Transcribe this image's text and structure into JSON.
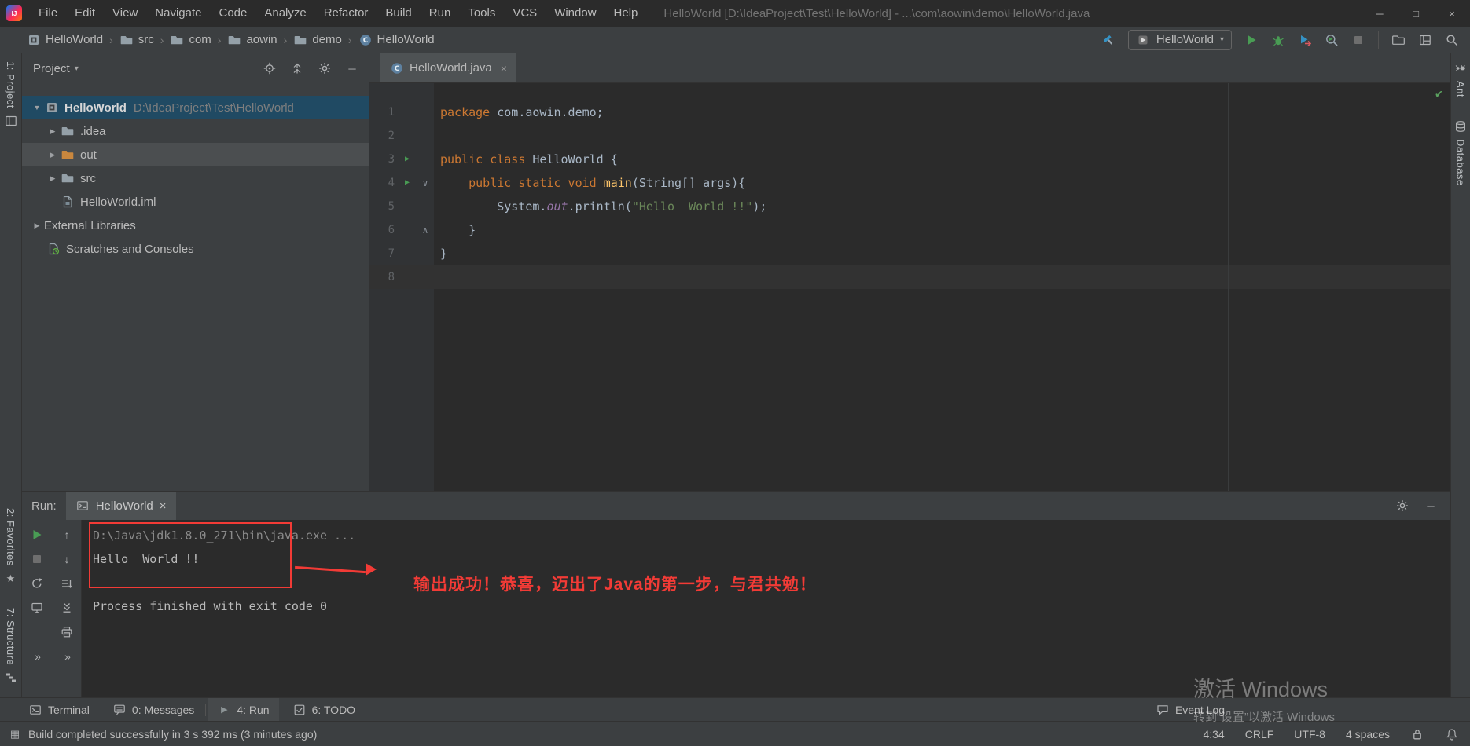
{
  "colors": {
    "keyword": "#CC7832",
    "string": "#6A8759",
    "method": "#FFC66B",
    "field": "#9876AA",
    "run_green": "#499C54",
    "annotation_red": "#F23B36",
    "selection_blue": "#204A63"
  },
  "window": {
    "title": "HelloWorld [D:\\IdeaProject\\Test\\HelloWorld] - ...\\com\\aowin\\demo\\HelloWorld.java",
    "menus": [
      "File",
      "Edit",
      "View",
      "Navigate",
      "Code",
      "Analyze",
      "Refactor",
      "Build",
      "Run",
      "Tools",
      "VCS",
      "Window",
      "Help"
    ]
  },
  "navbar": {
    "breadcrumbs": [
      {
        "label": "HelloWorld",
        "icon": "project"
      },
      {
        "label": "src",
        "icon": "folder"
      },
      {
        "label": "com",
        "icon": "folder"
      },
      {
        "label": "aowin",
        "icon": "folder"
      },
      {
        "label": "demo",
        "icon": "folder"
      },
      {
        "label": "HelloWorld",
        "icon": "class"
      }
    ],
    "config_label": "HelloWorld",
    "left_controls": [
      "build-hammer"
    ],
    "run_controls": [
      "run",
      "debug",
      "coverage",
      "profiler",
      "stop"
    ],
    "right_controls": [
      "toolwindow-folder",
      "hide-panels",
      "search-everywhere"
    ]
  },
  "stripes": {
    "left_top": [
      {
        "label": "1: Project",
        "icon": "project-tool"
      }
    ],
    "left_bottom": [
      {
        "label": "2: Favorites",
        "icon": "star"
      },
      {
        "label": "7: Structure",
        "icon": "structure"
      }
    ],
    "right": [
      {
        "label": "Ant",
        "icon": "ant"
      },
      {
        "label": "Database",
        "icon": "database"
      }
    ]
  },
  "project": {
    "header": "Project",
    "header_controls": [
      "locate",
      "collapse-all",
      "settings",
      "hide"
    ],
    "tree": [
      {
        "indent": 0,
        "arrow": "down",
        "icon": "project",
        "label": "HelloWorld",
        "suffix": "D:\\IdeaProject\\Test\\HelloWorld",
        "bold": true,
        "state": "selected"
      },
      {
        "indent": 1,
        "arrow": "right",
        "icon": "folder",
        "label": ".idea",
        "state": ""
      },
      {
        "indent": 1,
        "arrow": "right",
        "icon": "folder-excluded",
        "label": "out",
        "state": "hover"
      },
      {
        "indent": 1,
        "arrow": "right",
        "icon": "folder",
        "label": "src",
        "state": ""
      },
      {
        "indent": 1,
        "arrow": "none",
        "icon": "module-file",
        "label": "HelloWorld.iml",
        "state": ""
      },
      {
        "indent": 0,
        "arrow": "right",
        "icon": "",
        "label": "External Libraries",
        "state": ""
      },
      {
        "indent": 1,
        "arrow": "skip",
        "icon": "scratches",
        "label": "Scratches and Consoles",
        "state": ""
      }
    ]
  },
  "editor": {
    "tab": "HelloWorld.java",
    "code": [
      {
        "num": "1",
        "tokens": [
          {
            "t": "kw",
            "s": "package"
          },
          {
            "t": "pl",
            "s": " com.aowin.demo;"
          }
        ]
      },
      {
        "num": "2",
        "tokens": []
      },
      {
        "num": "3",
        "run": true,
        "tokens": [
          {
            "t": "kw",
            "s": "public class"
          },
          {
            "t": "pl",
            "s": " HelloWorld {"
          }
        ]
      },
      {
        "num": "4",
        "run": true,
        "fold": "down",
        "tokens": [
          {
            "t": "pl",
            "s": "    "
          },
          {
            "t": "kw",
            "s": "public static void"
          },
          {
            "t": "pl",
            "s": " "
          },
          {
            "t": "me",
            "s": "main"
          },
          {
            "t": "pl",
            "s": "(String[] args){"
          }
        ]
      },
      {
        "num": "5",
        "tokens": [
          {
            "t": "pl",
            "s": "        System."
          },
          {
            "t": "fi",
            "s": "out"
          },
          {
            "t": "pl",
            "s": ".println("
          },
          {
            "t": "st",
            "s": "\"Hello  World !!\""
          },
          {
            "t": "pl",
            "s": ");"
          }
        ]
      },
      {
        "num": "6",
        "fold": "up",
        "tokens": [
          {
            "t": "pl",
            "s": "    }"
          }
        ]
      },
      {
        "num": "7",
        "tokens": [
          {
            "t": "pl",
            "s": "}"
          }
        ]
      },
      {
        "num": "8",
        "caret": true,
        "tokens": []
      }
    ]
  },
  "run": {
    "label": "Run:",
    "tab": "HelloWorld",
    "header_controls": [
      "settings",
      "hide"
    ],
    "toolbar": [
      "rerun",
      "up",
      "stop",
      "down",
      "restart",
      "sort",
      "monitor",
      "scroll-end",
      "",
      "printer",
      "more",
      "more"
    ],
    "console": [
      {
        "kind": "cmd",
        "text": "D:\\Java\\jdk1.8.0_271\\bin\\java.exe ..."
      },
      {
        "kind": "out",
        "text": "Hello  World !!"
      },
      {
        "kind": "blank",
        "text": ""
      },
      {
        "kind": "sys",
        "text": "Process finished with exit code 0"
      }
    ],
    "annotation": "输出成功！恭喜，迈出了Java的第一步，与君共勉！"
  },
  "bottom": {
    "tabs": [
      {
        "icon": "terminal",
        "mnemonic": "",
        "label": "Terminal",
        "active": false
      },
      {
        "icon": "messages",
        "mnemonic": "0",
        "label": ": Messages",
        "active": false
      },
      {
        "icon": "run-small",
        "mnemonic": "4",
        "label": ": Run",
        "active": true
      },
      {
        "icon": "todo",
        "mnemonic": "6",
        "label": ": TODO",
        "active": false
      }
    ],
    "event_log": "Event Log"
  },
  "status": {
    "message": "Build completed successfully in 3 s 392 ms (3 minutes ago)",
    "items": [
      {
        "name": "caret-position",
        "text": "4:34"
      },
      {
        "name": "line-separator",
        "text": "CRLF"
      },
      {
        "name": "encoding",
        "text": "UTF-8"
      },
      {
        "name": "indent",
        "text": "4 spaces"
      }
    ]
  },
  "watermark": {
    "line1": "激活 Windows",
    "line2": "转到“设置”以激活 Windows"
  }
}
